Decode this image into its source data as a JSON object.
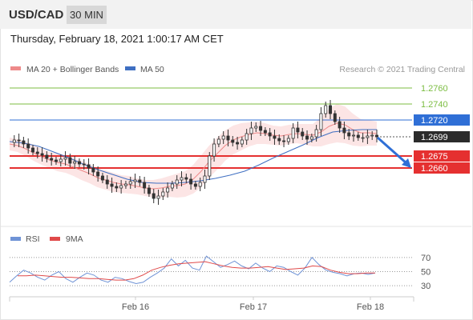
{
  "header": {
    "symbol": "USD/CAD",
    "timeframe": "30 MIN"
  },
  "timestamp": "Thursday, February 18, 2021 1:00:17 AM CET",
  "legend": {
    "ma20": "MA 20 + Bollinger Bands",
    "ma50": "MA 50",
    "rsi": "RSI",
    "ma9": "9MA"
  },
  "watermark": "Research © 2021 Trading Central",
  "colors": {
    "ma20": "#ee8a8a",
    "bands": "#fbe0e0",
    "ma50": "#3f6fc2",
    "resistance": "#7cbd42",
    "pivot": "#2f6fd6",
    "support": "#e53030",
    "price_tag": "#2b2b2b",
    "rsi": "#6f93d6",
    "ma9": "#e04a4a",
    "arrow": "#2f6fd6"
  },
  "chart_data": [
    {
      "type": "line",
      "title": "USD/CAD",
      "xlabel": "",
      "ylabel": "",
      "ylim": [
        1.2605,
        1.2775
      ],
      "x_ticks": [
        "Feb 16",
        "Feb 17",
        "Feb 18"
      ],
      "grid": false,
      "legend_position": "top-left",
      "levels": [
        {
          "value": 1.276,
          "label": "1.2760",
          "kind": "resistance"
        },
        {
          "value": 1.274,
          "label": "1.2740",
          "kind": "resistance"
        },
        {
          "value": 1.272,
          "label": "1.2720",
          "kind": "pivot"
        },
        {
          "value": 1.2699,
          "label": "1.2699",
          "kind": "last"
        },
        {
          "value": 1.2675,
          "label": "1.2675",
          "kind": "support"
        },
        {
          "value": 1.266,
          "label": "1.2660",
          "kind": "support"
        }
      ],
      "series": [
        {
          "name": "Price",
          "values": [
            1.2692,
            1.2695,
            1.2694,
            1.269,
            1.2685,
            1.268,
            1.2678,
            1.2676,
            1.2672,
            1.267,
            1.2668,
            1.2671,
            1.2673,
            1.2666,
            1.2668,
            1.2665,
            1.2664,
            1.266,
            1.2655,
            1.265,
            1.2645,
            1.264,
            1.2637,
            1.2635,
            1.2638,
            1.264,
            1.2643,
            1.2645,
            1.2642,
            1.2635,
            1.2628,
            1.2622,
            1.2625,
            1.263,
            1.2635,
            1.264,
            1.2645,
            1.2648,
            1.2646,
            1.264,
            1.2637,
            1.2642,
            1.265,
            1.2675,
            1.269,
            1.2696,
            1.27,
            1.2695,
            1.2692,
            1.269,
            1.2695,
            1.2703,
            1.271,
            1.2712,
            1.2707,
            1.2704,
            1.27,
            1.2697,
            1.2694,
            1.2693,
            1.2697,
            1.271,
            1.2705,
            1.27,
            1.2696,
            1.2699,
            1.2708,
            1.2728,
            1.2738,
            1.2728,
            1.2718,
            1.271,
            1.2704,
            1.27,
            1.2701,
            1.2698,
            1.2698,
            1.27,
            1.2701,
            1.2699
          ]
        },
        {
          "name": "MA 20",
          "values": [
            1.269,
            1.2688,
            1.2684,
            1.2679,
            1.2674,
            1.267,
            1.2667,
            1.2665,
            1.2661,
            1.2657,
            1.2653,
            1.2648,
            1.2645,
            1.2642,
            1.264,
            1.2639,
            1.2637,
            1.2635,
            1.2634,
            1.2635,
            1.2637,
            1.2638,
            1.264,
            1.2646,
            1.2656,
            1.2668,
            1.2678,
            1.2688,
            1.2695,
            1.2699,
            1.2702,
            1.2704,
            1.2703,
            1.2701,
            1.27,
            1.2702,
            1.2703,
            1.2702,
            1.2701,
            1.2705,
            1.2712,
            1.2716,
            1.2714,
            1.2708,
            1.2704,
            1.2704,
            1.2703
          ]
        },
        {
          "name": "MA 50",
          "values": [
            1.2693,
            1.2691,
            1.2687,
            1.268,
            1.2673,
            1.2665,
            1.2658,
            1.2652,
            1.2646,
            1.2642,
            1.2641,
            1.2641,
            1.2642,
            1.2644,
            1.2647,
            1.2651,
            1.2656,
            1.2664,
            1.2673,
            1.2681,
            1.2689,
            1.2698,
            1.2705,
            1.2707,
            1.2708,
            1.2708
          ]
        }
      ]
    },
    {
      "type": "line",
      "title": "",
      "xlabel": "",
      "ylabel": "",
      "ylim": [
        20,
        80
      ],
      "y_ticks": [
        "70",
        "50",
        "30"
      ],
      "series": [
        {
          "name": "RSI",
          "values": [
            35,
            44,
            52,
            48,
            42,
            38,
            45,
            50,
            40,
            35,
            42,
            48,
            45,
            38,
            35,
            42,
            40,
            36,
            33,
            35,
            42,
            48,
            55,
            68,
            58,
            66,
            55,
            52,
            72,
            64,
            56,
            60,
            65,
            58,
            54,
            62,
            55,
            50,
            58,
            56,
            50,
            45,
            55,
            70,
            60,
            52,
            49,
            47,
            44,
            47,
            48,
            46,
            48
          ]
        },
        {
          "name": "9MA",
          "values": [
            44,
            44,
            45,
            44,
            43,
            42,
            42,
            41,
            40,
            40,
            39,
            38,
            38,
            40,
            45,
            52,
            56,
            59,
            61,
            62,
            63,
            64,
            61,
            58,
            56,
            55,
            55,
            56,
            57,
            55,
            53,
            54,
            55,
            58,
            57,
            52,
            49,
            47,
            47,
            48,
            48
          ]
        }
      ]
    }
  ]
}
